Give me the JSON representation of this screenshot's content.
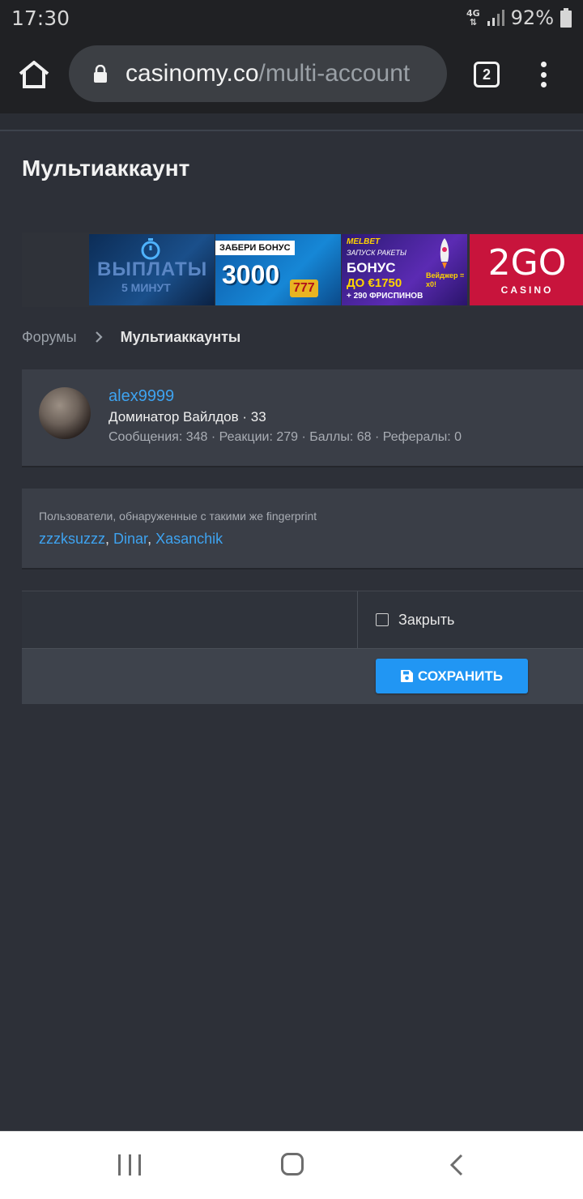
{
  "status_bar": {
    "time": "17:30",
    "network": "4G",
    "battery": "92%"
  },
  "browser": {
    "url_host": "casinomy.co",
    "url_path": "/multi-account",
    "tab_count": "2"
  },
  "page": {
    "title": "Мультиаккаунт"
  },
  "ads": [
    {
      "text_main": "ВЫПЛАТЫ",
      "text_sub": "5 МИНУТ"
    },
    {
      "text_top": "ЗАБЕРИ БОНУС",
      "text_main": "3000",
      "text_sub": "777"
    },
    {
      "brand": "MELBET",
      "text_top": "ЗАПУСК РАКЕТЫ",
      "text_main": "БОНУС",
      "text_amount": "ДО €1750",
      "text_sub": "+ 290 ФРИСПИНОВ",
      "text_badge": "Вейджер = х0!"
    },
    {
      "text_main": "2GO",
      "text_sub": "CASINO"
    }
  ],
  "breadcrumb": {
    "forums": "Форумы",
    "current": "Мультиаккаунты"
  },
  "member": {
    "name": "alex9999",
    "title": "Доминатор Вайлдов · 33",
    "stats": "Сообщения: 348 · Реакции: 279 · Баллы: 68 · Рефералы: 0"
  },
  "fingerprint": {
    "label": "Пользователи, обнаруженные с такими же fingerprint",
    "users": [
      "zzzksuzzz",
      "Dinar",
      "Xasanchik"
    ],
    "separator": ", "
  },
  "form": {
    "close_label": "Закрыть",
    "save_label": "СОХРАНИТЬ"
  }
}
